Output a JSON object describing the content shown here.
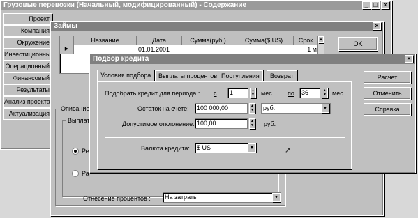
{
  "main_window": {
    "title": "Грузовые перевозки (Начальный, модифицированный) - Содержание",
    "sidebar": [
      "Проект",
      "Компания",
      "Окружение",
      "Инвестиционный",
      "Операционный",
      "Финансовый",
      "Результаты",
      "Анализ проекта",
      "Актуализация"
    ]
  },
  "loans_window": {
    "title": "Займы",
    "columns": [
      "Название",
      "Дата",
      "Сумма(руб.)",
      "Сумма($ US)",
      "Срок"
    ],
    "row": {
      "date": "01.01.2001",
      "term": "1 м"
    },
    "ok_label": "OK",
    "description_label": "Описание",
    "payments_label": "Выплаты",
    "radio1_label": "Ре",
    "radio2_label": "Ра",
    "interest_label": "Отнесение процентов :",
    "interest_value": "На затраты"
  },
  "credit_dialog": {
    "title": "Подбор кредита",
    "tabs": [
      "Условия подбора",
      "Выплаты процентов",
      "Поступления",
      "Возврат"
    ],
    "period_label": "Подобрать кредит для периода :",
    "from_label": "с",
    "from_value": "1",
    "from_unit": "мес.",
    "to_label": "по",
    "to_value": "36",
    "to_unit": "мес.",
    "balance_label": "Остаток на счете:",
    "balance_value": "100 000,00",
    "balance_currency": "руб.",
    "deviation_label": "Допустимое отклонение:",
    "deviation_value": "100,00",
    "deviation_unit": "руб.",
    "currency_label": "Валюта кредита:",
    "currency_value": "$ US",
    "buttons": {
      "calc": "Расчет",
      "cancel": "Отменить",
      "help": "Справка"
    }
  }
}
